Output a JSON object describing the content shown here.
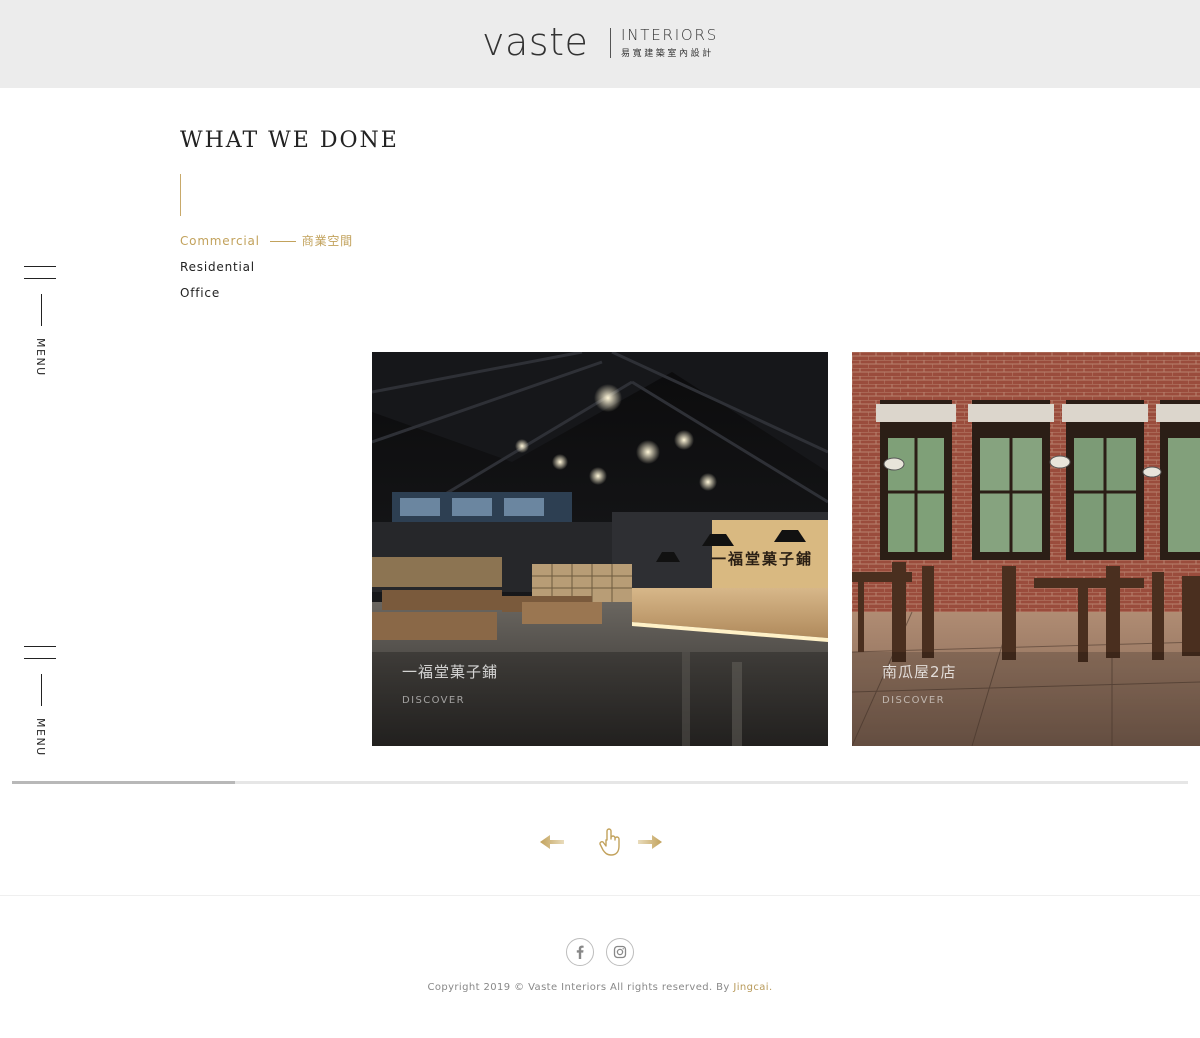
{
  "header": {
    "logo_word": "vaste",
    "logo_interiors": "INTERIORS",
    "logo_cn": "易寬建築室內設計"
  },
  "side_menu": {
    "label": "MENU"
  },
  "main": {
    "title": "WHAT WE DONE",
    "categories": [
      {
        "label": "Commercial",
        "cn": "商業空間",
        "active": true
      },
      {
        "label": "Residential",
        "active": false
      },
      {
        "label": "Office",
        "active": false
      }
    ]
  },
  "projects": [
    {
      "title": "一福堂菓子鋪",
      "link": "DISCOVER",
      "sign_text": "一福堂菓子鋪"
    },
    {
      "title": "南瓜屋2店",
      "link": "DISCOVER"
    }
  ],
  "scroll": {
    "progress": 0.19
  },
  "nav": {
    "prev_icon": "arrow-left-icon",
    "drag_icon": "hand-pointer-icon",
    "next_icon": "arrow-right-icon"
  },
  "footer": {
    "social": [
      "facebook-icon",
      "instagram-icon"
    ],
    "copyright": "Copyright 2019 © Vaste Interiors All rights reserved. By",
    "by": "Jingcai."
  },
  "colors": {
    "accent": "#c2a25c",
    "header_bg": "#ececec"
  }
}
